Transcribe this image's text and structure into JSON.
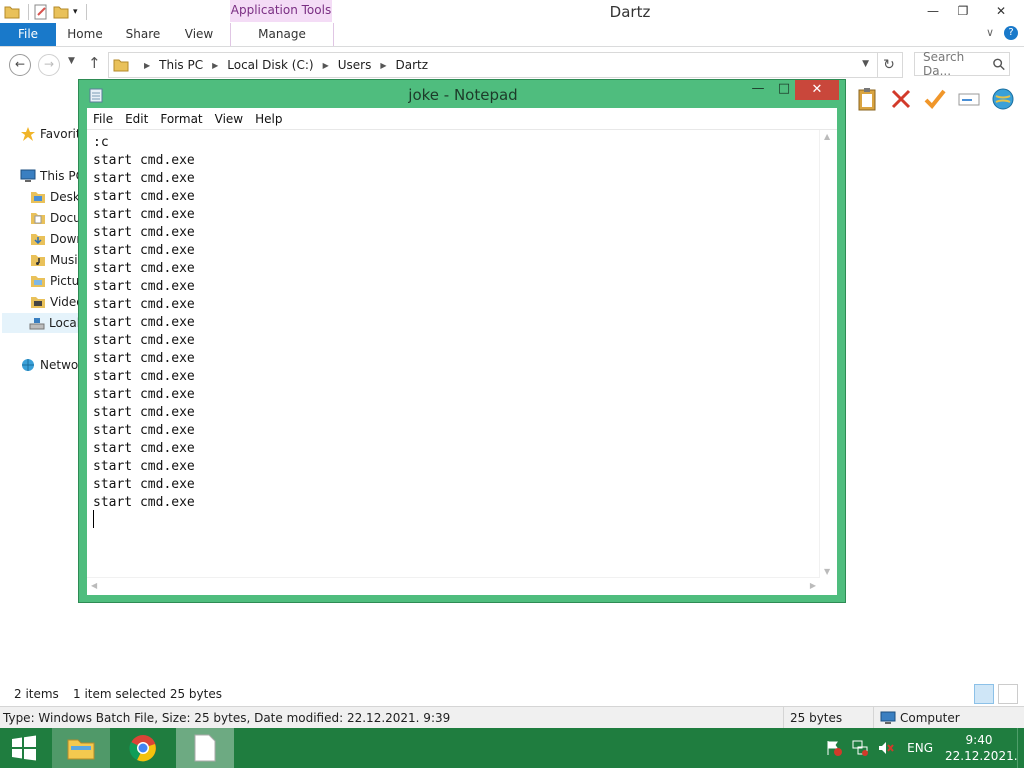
{
  "explorer": {
    "title": "Dartz",
    "app_tools_header": "Application Tools",
    "tabs": {
      "file": "File",
      "home": "Home",
      "share": "Share",
      "view": "View",
      "manage": "Manage"
    },
    "breadcrumb": [
      "This PC",
      "Local Disk (C:)",
      "Users",
      "Dartz"
    ],
    "search_placeholder": "Search Da...",
    "nav_pane": {
      "favorites": "Favorit",
      "this_pc": "This PC",
      "items": [
        "Deskt",
        "Docu",
        "Down",
        "Musi",
        "Pictu",
        "Video",
        "Local"
      ],
      "network": "Networ"
    },
    "status": {
      "items": "2 items",
      "selected": "1 item selected  25 bytes"
    },
    "details": {
      "text": "Type: Windows Batch File, Size: 25 bytes, Date modified: 22.12.2021. 9:39",
      "size": "25 bytes",
      "location": "Computer"
    }
  },
  "notepad": {
    "title": "joke - Notepad",
    "menu": [
      "File",
      "Edit",
      "Format",
      "View",
      "Help"
    ],
    "lines": [
      ":c",
      "start cmd.exe",
      "start cmd.exe",
      "start cmd.exe",
      "start cmd.exe",
      "start cmd.exe",
      "start cmd.exe",
      "start cmd.exe",
      "start cmd.exe",
      "start cmd.exe",
      "start cmd.exe",
      "start cmd.exe",
      "start cmd.exe",
      "start cmd.exe",
      "start cmd.exe",
      "start cmd.exe",
      "start cmd.exe",
      "start cmd.exe",
      "start cmd.exe",
      "start cmd.exe",
      "start cmd.exe"
    ]
  },
  "taskbar": {
    "language": "ENG",
    "time": "9:40",
    "date": "22.12.2021."
  },
  "colors": {
    "notepad_frame": "#4fbd7e",
    "taskbar": "#1f7d3f",
    "file_tab": "#1979ca",
    "close_button": "#c9473b",
    "app_tools": "#f4dcf6"
  }
}
